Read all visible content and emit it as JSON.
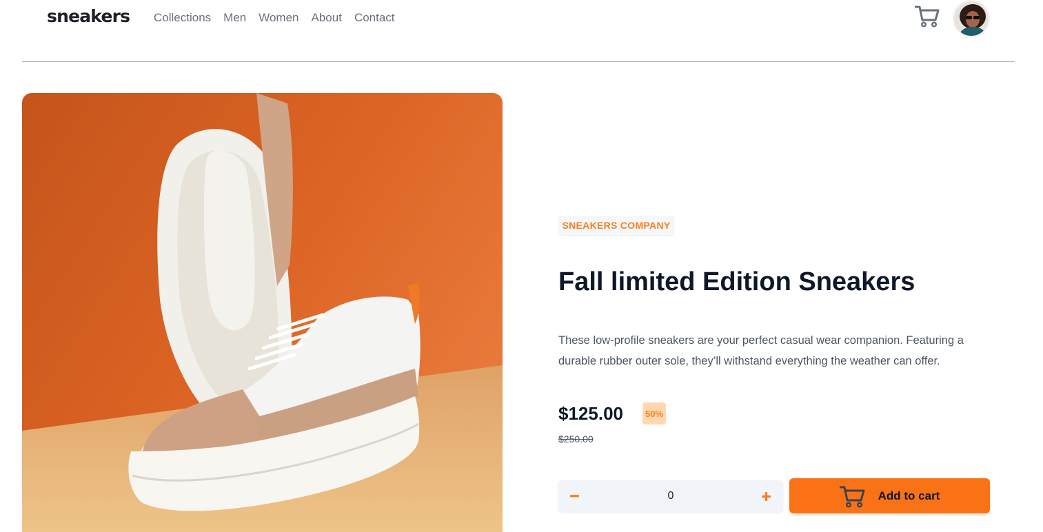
{
  "header": {
    "logo": "sneakers",
    "nav": [
      "Collections",
      "Men",
      "Women",
      "About",
      "Contact"
    ],
    "cart_icon": "cart-icon",
    "avatar_icon": "user-avatar"
  },
  "product": {
    "company": "SNEAKERS COMPANY",
    "title": "Fall limited Edition Sneakers",
    "description": "These low-profile sneakers are your perfect casual wear companion. Featuring a durable rubber outer sole, they’ll withstand everything the weather can offer.",
    "price": "$125.00",
    "discount": "50%",
    "original_price": "$250.00",
    "quantity": "0",
    "add_to_cart_label": "Add to cart"
  },
  "colors": {
    "accent": "#ff7d1a",
    "button": "#f97316",
    "text_dark": "#0f172a",
    "text_muted": "#69707d"
  }
}
